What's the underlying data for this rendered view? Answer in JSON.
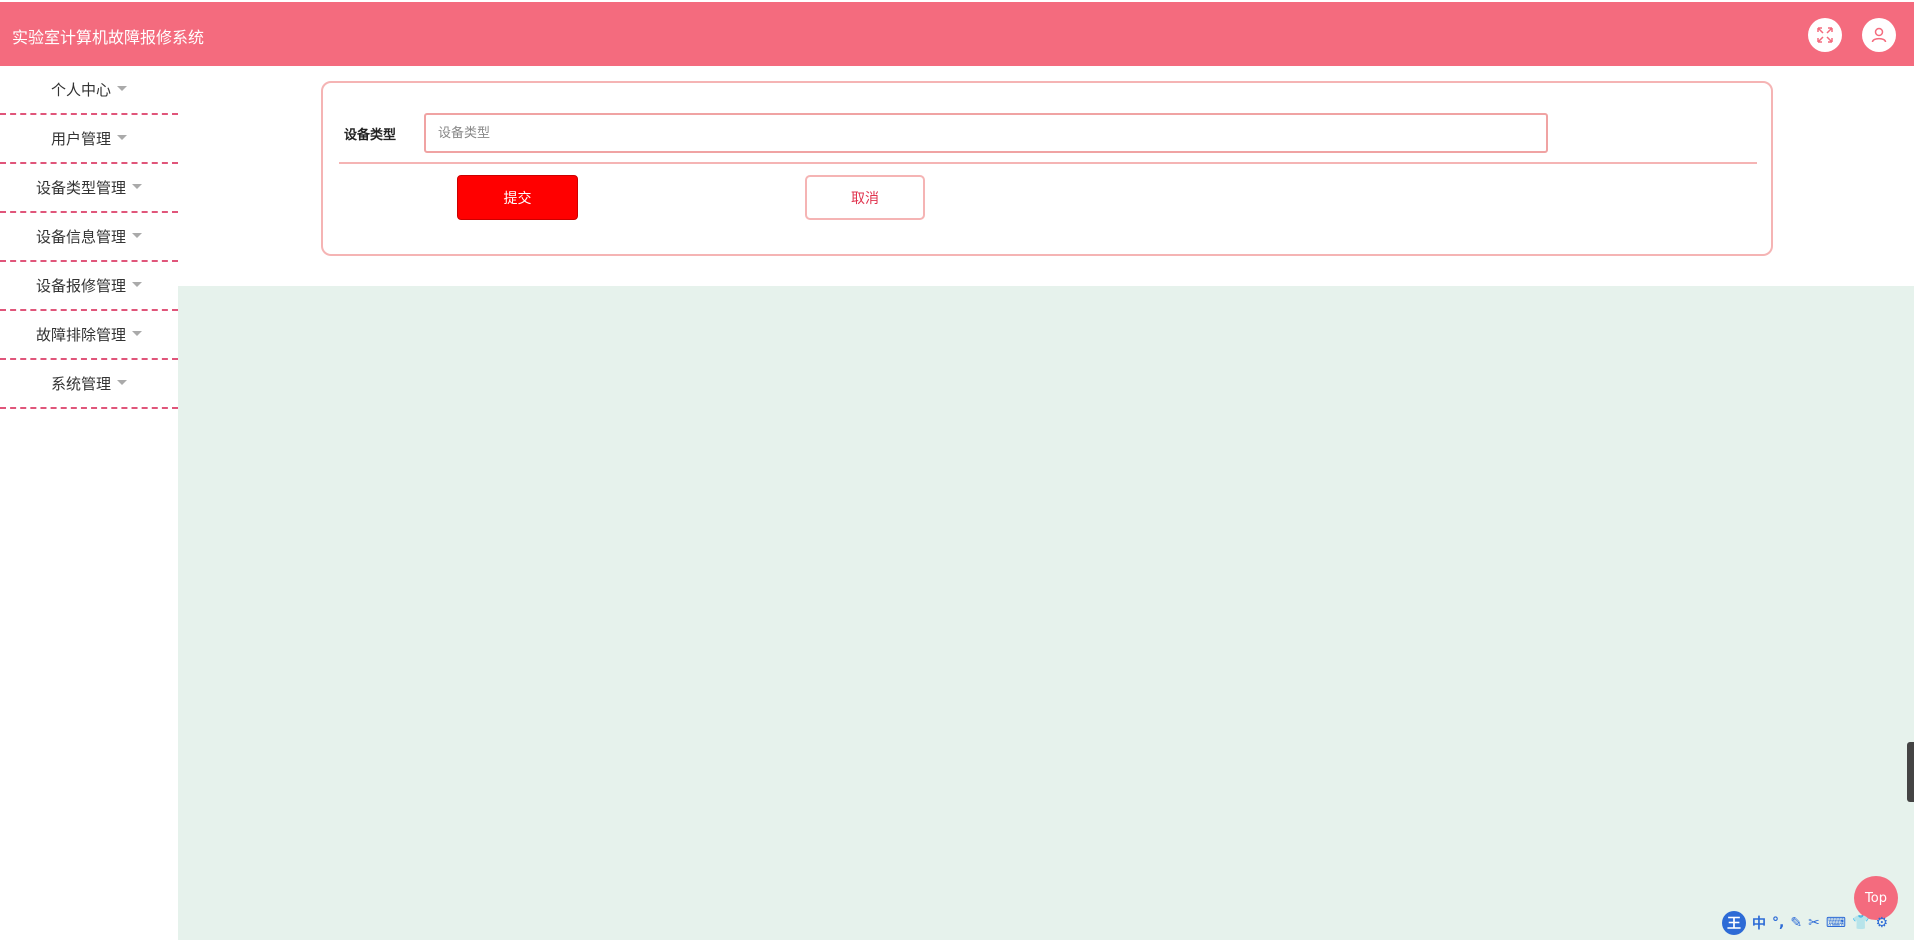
{
  "header": {
    "title": "实验室计算机故障报修系统"
  },
  "sidebar": {
    "items": [
      {
        "label": "个人中心"
      },
      {
        "label": "用户管理"
      },
      {
        "label": "设备类型管理"
      },
      {
        "label": "设备信息管理"
      },
      {
        "label": "设备报修管理"
      },
      {
        "label": "故障排除管理"
      },
      {
        "label": "系统管理"
      }
    ]
  },
  "form": {
    "device_type_label": "设备类型",
    "device_type_placeholder": "设备类型",
    "device_type_value": "",
    "submit_label": "提交",
    "cancel_label": "取消"
  },
  "back_to_top_label": "Top",
  "ime_toolbar": {
    "logo": "王",
    "items": [
      "中",
      "°,",
      "✎",
      "✂",
      "⌨",
      "👕",
      "⚙"
    ]
  },
  "colors": {
    "header": "#f46b7e",
    "submit": "#ff0000",
    "content_bg": "#e6f2ec",
    "accent_border": "#f5b4b4"
  }
}
